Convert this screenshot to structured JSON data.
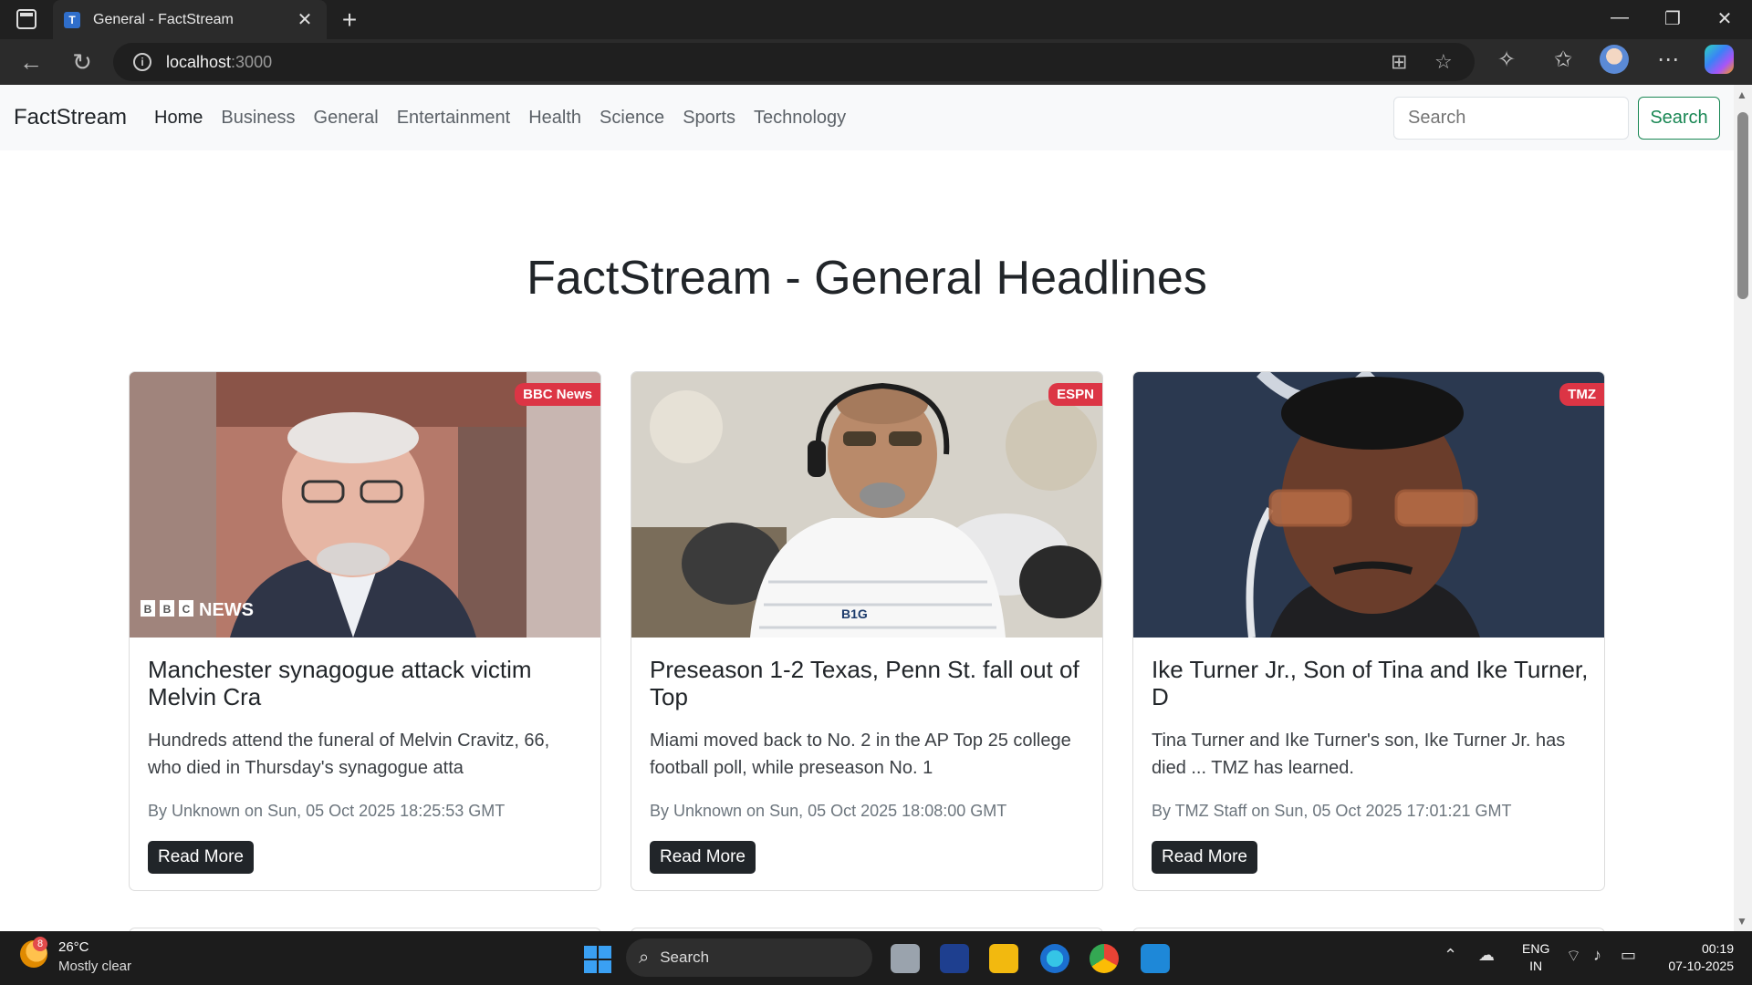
{
  "browser": {
    "tab_title": "General - FactStream",
    "tab_favicon": "T",
    "url_host": "localhost",
    "url_port": ":3000"
  },
  "navbar": {
    "brand": "FactStream",
    "links": [
      "Home",
      "Business",
      "General",
      "Entertainment",
      "Health",
      "Science",
      "Sports",
      "Technology"
    ],
    "search_placeholder": "Search",
    "search_button": "Search"
  },
  "main": {
    "heading": "FactStream - General Headlines",
    "cards": [
      {
        "source": "BBC News",
        "image_watermark": "NEWS",
        "title": "Manchester synagogue attack victim Melvin Cra",
        "description": "Hundreds attend the funeral of Melvin Cravitz, 66, who died in Thursday's synagogue atta",
        "meta": "By Unknown on Sun, 05 Oct 2025 18:25:53 GMT",
        "button": "Read More"
      },
      {
        "source": "ESPN",
        "image_watermark": "B1G",
        "title": "Preseason 1-2 Texas, Penn St. fall out of Top",
        "description": "Miami moved back to No. 2 in the AP Top 25 college football poll, while preseason No. 1",
        "meta": "By Unknown on Sun, 05 Oct 2025 18:08:00 GMT",
        "button": "Read More"
      },
      {
        "source": "TMZ",
        "title": "Ike Turner Jr., Son of Tina and Ike Turner, D",
        "description": "Tina Turner and Ike Turner's son, Ike Turner Jr. has died ... TMZ has learned.",
        "meta": "By TMZ Staff on Sun, 05 Oct 2025 17:01:21 GMT",
        "button": "Read More"
      }
    ]
  },
  "taskbar": {
    "weather_badge": "8",
    "temperature": "26°C",
    "condition": "Mostly clear",
    "search_label": "Search",
    "lang_line1": "ENG",
    "lang_line2": "IN",
    "time": "00:19",
    "date": "07-10-2025"
  }
}
